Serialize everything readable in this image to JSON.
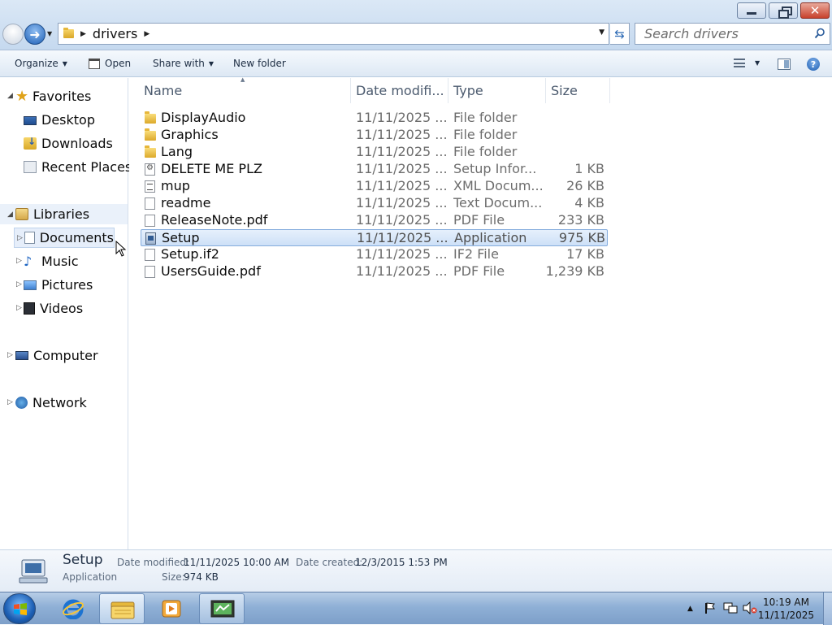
{
  "address": {
    "crumb": "drivers",
    "search_placeholder": "Search drivers"
  },
  "toolbar": {
    "organize": "Organize",
    "open": "Open",
    "share_with": "Share with",
    "new_folder": "New folder"
  },
  "nav": {
    "favorites": "Favorites",
    "desktop": "Desktop",
    "downloads": "Downloads",
    "recent_places": "Recent Places",
    "libraries": "Libraries",
    "documents": "Documents",
    "music": "Music",
    "pictures": "Pictures",
    "videos": "Videos",
    "computer": "Computer",
    "network": "Network"
  },
  "columns": {
    "name": "Name",
    "date_modified": "Date modifi...",
    "type": "Type",
    "size": "Size"
  },
  "files": [
    {
      "name": "DisplayAudio",
      "date": "11/11/2025 ...",
      "type": "File folder",
      "size": "",
      "icon": "folder-icon"
    },
    {
      "name": "Graphics",
      "date": "11/11/2025 ...",
      "type": "File folder",
      "size": "",
      "icon": "folder-icon"
    },
    {
      "name": "Lang",
      "date": "11/11/2025 ...",
      "type": "File folder",
      "size": "",
      "icon": "folder-icon"
    },
    {
      "name": "DELETE ME PLZ",
      "date": "11/11/2025 ...",
      "type": "Setup Infor...",
      "size": "1 KB",
      "icon": "setup-info-icon"
    },
    {
      "name": "mup",
      "date": "11/11/2025 ...",
      "type": "XML Docum...",
      "size": "26 KB",
      "icon": "xml-file-icon"
    },
    {
      "name": "readme",
      "date": "11/11/2025 ...",
      "type": "Text Docum...",
      "size": "4 KB",
      "icon": "text-file-icon"
    },
    {
      "name": "ReleaseNote.pdf",
      "date": "11/11/2025 ...",
      "type": "PDF File",
      "size": "233 KB",
      "icon": "pdf-file-icon"
    },
    {
      "name": "Setup",
      "date": "11/11/2025 ...",
      "type": "Application",
      "size": "975 KB",
      "icon": "application-icon",
      "selected": true
    },
    {
      "name": "Setup.if2",
      "date": "11/11/2025 ...",
      "type": "IF2 File",
      "size": "17 KB",
      "icon": "file-icon"
    },
    {
      "name": "UsersGuide.pdf",
      "date": "11/11/2025 ...",
      "type": "PDF File",
      "size": "1,239 KB",
      "icon": "pdf-file-icon"
    }
  ],
  "details": {
    "name": "Setup",
    "kind": "Application",
    "date_modified_label": "Date modified:",
    "date_modified": "11/11/2025 10:00 AM",
    "date_created_label": "Date created:",
    "date_created": "12/3/2015 1:53 PM",
    "size_label": "Size:",
    "size": "974 KB"
  },
  "taskbar": {
    "time": "10:19 AM",
    "date": "11/11/2025"
  },
  "colors": {
    "selection": "#cde0f7",
    "selection_border": "#84acdd",
    "taskbar": "#8fb0d6"
  }
}
